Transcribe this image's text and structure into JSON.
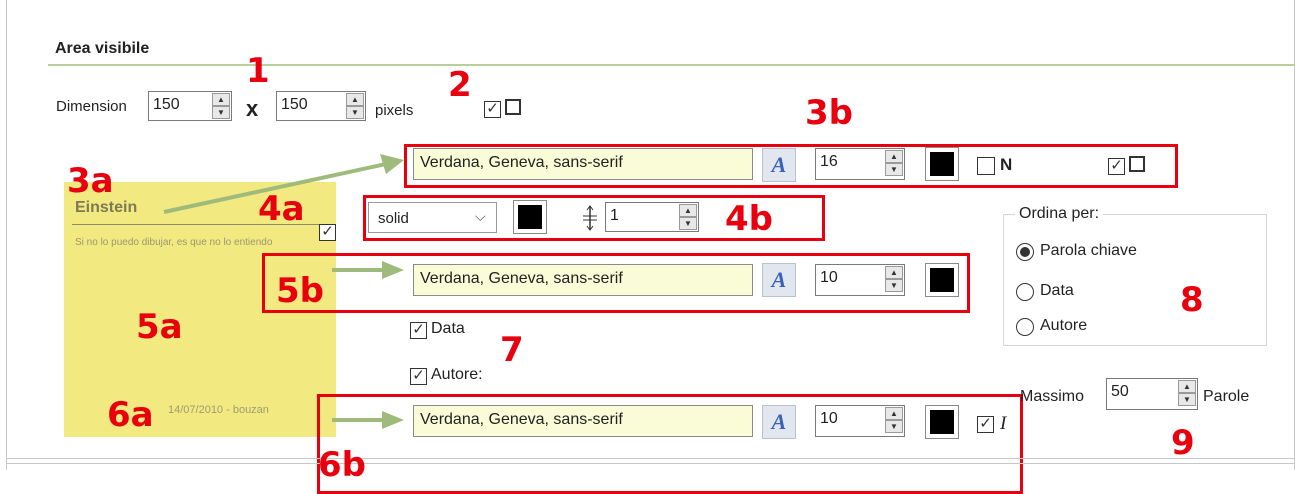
{
  "section": {
    "title": "Area visibile"
  },
  "dimension": {
    "label": "Dimension",
    "width": "150",
    "times": "x",
    "height": "150",
    "unit": "pixels"
  },
  "title_font": {
    "family": "Verdana, Geneva, sans-serif",
    "size": "16",
    "bold_label": "N"
  },
  "border": {
    "style": "solid",
    "width": "1"
  },
  "text_font": {
    "family": "Verdana, Geneva, sans-serif",
    "size": "10"
  },
  "options": {
    "date_label": "Data",
    "author_label": "Autore:"
  },
  "meta_font": {
    "family": "Verdana, Geneva, sans-serif",
    "size": "10",
    "italic_label": "I"
  },
  "sort": {
    "legend": "Ordina per:",
    "options": [
      "Parola chiave",
      "Data",
      "Autore"
    ],
    "selected": 0
  },
  "max": {
    "label": "Massimo",
    "value": "50",
    "unit": "Parole"
  },
  "preview": {
    "title": "Einstein",
    "text": "Si no lo puedo dibujar, es que no lo entiendo",
    "footer": "14/07/2010 - bouzan"
  },
  "annotations": {
    "n1": "1",
    "n2": "2",
    "n3a": "3a",
    "n3b": "3b",
    "n4a": "4a",
    "n4b": "4b",
    "n5a": "5a",
    "n5b": "5b",
    "n6a": "6a",
    "n6b": "6b",
    "n7": "7",
    "n8": "8",
    "n9": "9"
  }
}
